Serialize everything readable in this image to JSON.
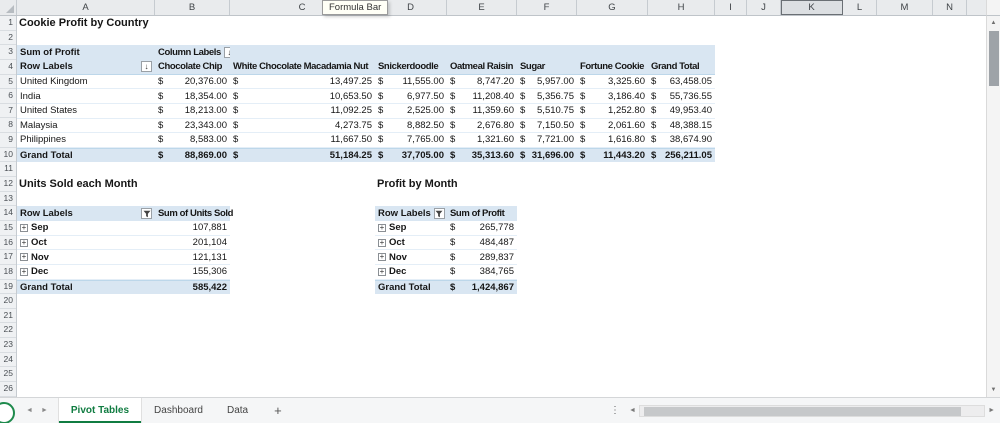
{
  "app": {
    "tooltip": "Formula Bar",
    "column_letters": [
      "A",
      "B",
      "C",
      "D",
      "E",
      "F",
      "G",
      "H",
      "I",
      "J",
      "K",
      "L",
      "M",
      "N"
    ],
    "selected_column": "K",
    "row_count": 26
  },
  "titles": {
    "main": "Cookie Profit by Country",
    "units": "Units Sold each Month",
    "profit_month": "Profit by Month"
  },
  "main_pivot": {
    "corner_label": "Sum of Profit",
    "column_labels_label": "Column Labels",
    "row_labels_label": "Row Labels",
    "currency_symbol": "$",
    "columns": [
      "Chocolate Chip",
      "White Chocolate Macadamia Nut",
      "Snickerdoodle",
      "Oatmeal Raisin",
      "Sugar",
      "Fortune Cookie",
      "Grand Total"
    ],
    "rows": [
      {
        "label": "United Kingdom",
        "values": [
          "20,376.00",
          "13,497.25",
          "11,555.00",
          "8,747.20",
          "5,957.00",
          "3,325.60",
          "63,458.05"
        ]
      },
      {
        "label": "India",
        "values": [
          "18,354.00",
          "10,653.50",
          "6,977.50",
          "11,208.40",
          "5,356.75",
          "3,186.40",
          "55,736.55"
        ]
      },
      {
        "label": "United States",
        "values": [
          "18,213.00",
          "11,092.25",
          "2,525.00",
          "11,359.60",
          "5,510.75",
          "1,252.80",
          "49,953.40"
        ]
      },
      {
        "label": "Malaysia",
        "values": [
          "23,343.00",
          "4,273.75",
          "8,882.50",
          "2,676.80",
          "7,150.50",
          "2,061.60",
          "48,388.15"
        ]
      },
      {
        "label": "Philippines",
        "values": [
          "8,583.00",
          "11,667.50",
          "7,765.00",
          "1,321.60",
          "7,721.00",
          "1,616.80",
          "38,674.90"
        ]
      }
    ],
    "grand_total": {
      "label": "Grand Total",
      "values": [
        "88,869.00",
        "51,184.25",
        "37,705.00",
        "35,313.60",
        "31,696.00",
        "11,443.20",
        "256,211.05"
      ]
    }
  },
  "units_pivot": {
    "row_labels_label": "Row Labels",
    "value_label": "Sum of Units Sold",
    "rows": [
      {
        "label": "Sep",
        "value": "107,881"
      },
      {
        "label": "Oct",
        "value": "201,104"
      },
      {
        "label": "Nov",
        "value": "121,131"
      },
      {
        "label": "Dec",
        "value": "155,306"
      }
    ],
    "grand_total": {
      "label": "Grand Total",
      "value": "585,422"
    }
  },
  "profit_pivot": {
    "row_labels_label": "Row Labels",
    "value_label": "Sum of Profit",
    "currency_symbol": "$",
    "rows": [
      {
        "label": "Sep",
        "value": "265,778"
      },
      {
        "label": "Oct",
        "value": "484,487"
      },
      {
        "label": "Nov",
        "value": "289,837"
      },
      {
        "label": "Dec",
        "value": "384,765"
      }
    ],
    "grand_total": {
      "label": "Grand Total",
      "value": "1,424,867"
    }
  },
  "sheet_tabs": {
    "tabs": [
      {
        "label": "Pivot Tables",
        "active": true
      },
      {
        "label": "Dashboard",
        "active": false
      },
      {
        "label": "Data",
        "active": false
      }
    ],
    "add_label": "+"
  },
  "icons": {
    "sort_desc": "↓",
    "expand": "+",
    "nav_left": "◄",
    "nav_right": "►",
    "scroll_up": "▲",
    "scroll_down": "▼",
    "scroll_left": "◄",
    "scroll_right": "►",
    "more": "⋮"
  },
  "colors": {
    "pivot_fill": "#D9E6F2",
    "pivot_line": "#BDD7EA",
    "row_separator": "#E4EEF7",
    "tab_green": "#107C41"
  }
}
